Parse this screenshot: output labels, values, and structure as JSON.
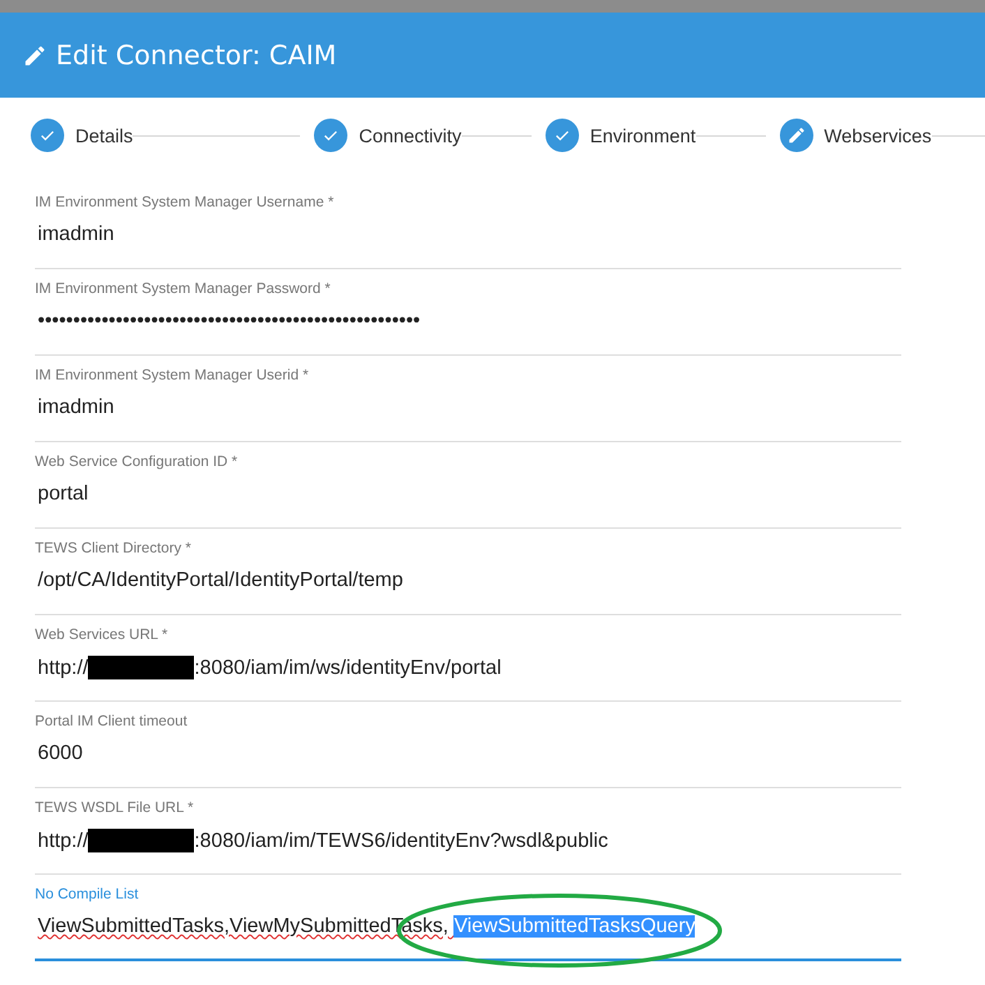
{
  "header": {
    "title": "Edit Connector: CAIM"
  },
  "steps": [
    {
      "label": "Details",
      "completed": true
    },
    {
      "label": "Connectivity",
      "completed": true
    },
    {
      "label": "Environment",
      "completed": true
    },
    {
      "label": "Webservices",
      "completed": false
    }
  ],
  "fields": [
    {
      "kind": "text",
      "label": "IM Environment System Manager Username *",
      "value": "imadmin"
    },
    {
      "kind": "password",
      "label": "IM Environment System Manager Password *",
      "value": "••••••••••••••••••••••••••••••••••••••••••••••••••••••"
    },
    {
      "kind": "text",
      "label": "IM Environment System Manager Userid *",
      "value": "imadmin"
    },
    {
      "kind": "text",
      "label": "Web Service Configuration ID *",
      "value": "portal"
    },
    {
      "kind": "text",
      "label": "TEWS Client Directory *",
      "value": "/opt/CA/IdentityPortal/IdentityPortal/temp"
    },
    {
      "kind": "redacted",
      "label": "Web Services URL *",
      "prefix": "http://",
      "suffix": ":8080/iam/im/ws/identityEnv/portal"
    },
    {
      "kind": "text",
      "label": "Portal IM Client timeout",
      "value": "6000"
    },
    {
      "kind": "redacted",
      "label": "TEWS WSDL File URL *",
      "prefix": "http://",
      "suffix": ":8080/iam/im/TEWS6/identityEnv?wsdl&public"
    },
    {
      "kind": "selection",
      "label": "No Compile List",
      "focused": true,
      "circled": true,
      "parts": [
        {
          "text": "ViewSubmittedTasks,ViewMySubmittedTasks, ",
          "selected": false
        },
        {
          "text": "ViewSubmittedTasksQuery",
          "selected": true
        }
      ]
    }
  ]
}
